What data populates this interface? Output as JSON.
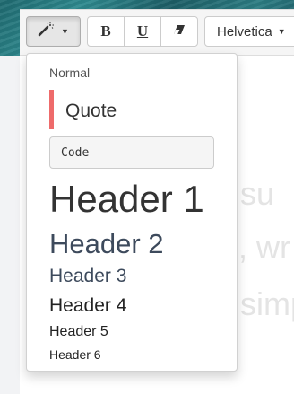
{
  "toolbar": {
    "style_icon": "magic-wand-icon",
    "bold_label": "B",
    "underline_label": "U",
    "eraser_icon": "eraser-icon",
    "font_name": "Helvetica"
  },
  "editor": {
    "background_text": [
      "su",
      ", wr",
      "simp"
    ]
  },
  "style_menu": {
    "items": [
      {
        "label": "Normal"
      },
      {
        "label": "Quote"
      },
      {
        "label": "Code"
      },
      {
        "label": "Header 1"
      },
      {
        "label": "Header 2"
      },
      {
        "label": "Header 3"
      },
      {
        "label": "Header 4"
      },
      {
        "label": "Header 5"
      },
      {
        "label": "Header 6"
      }
    ],
    "quote_color": "#ee6b6b"
  }
}
